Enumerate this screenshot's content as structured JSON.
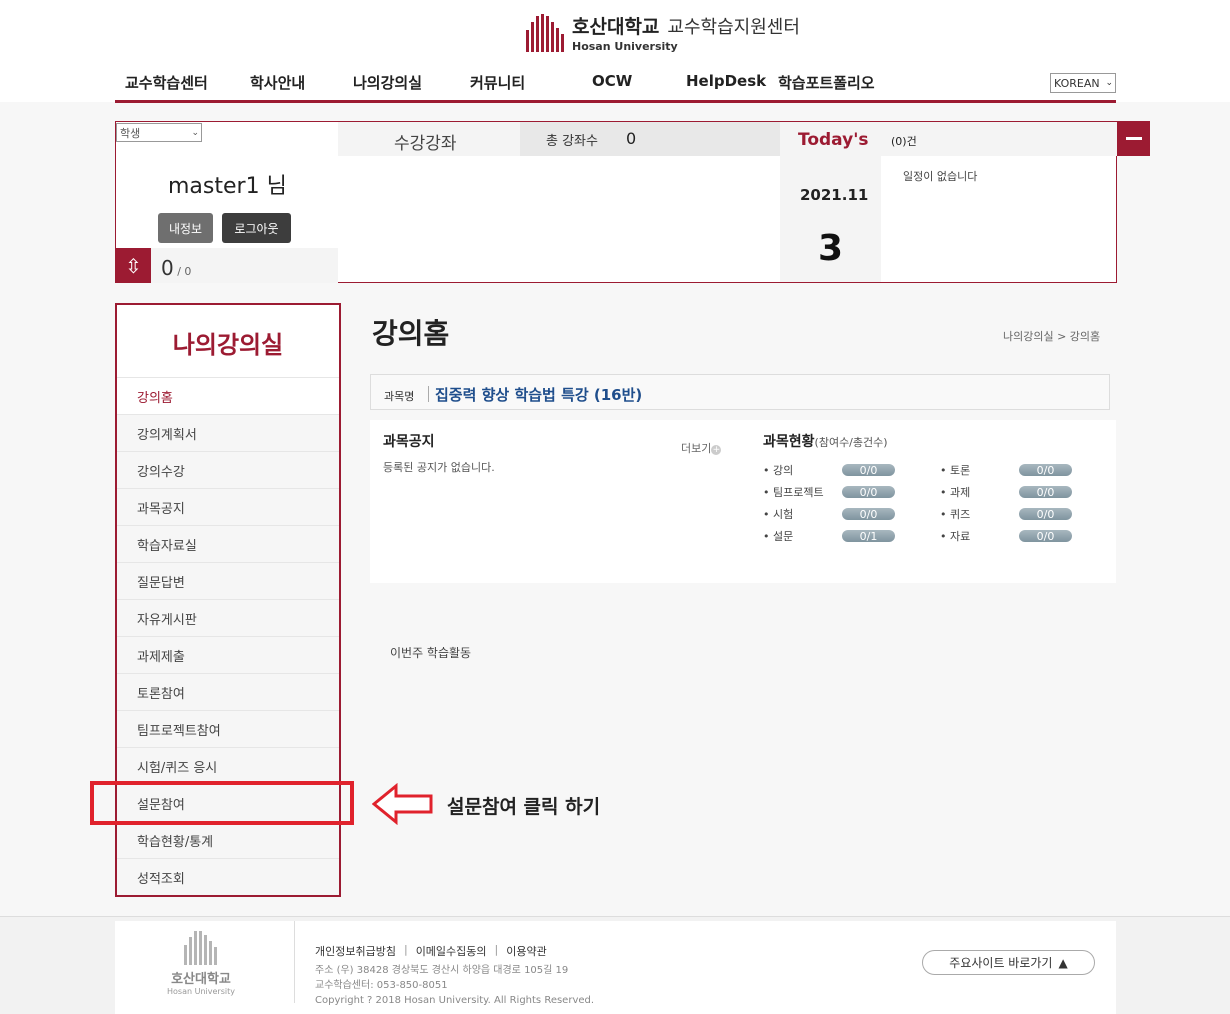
{
  "header": {
    "logo_kr": "호산대학교",
    "logo_center": "교수학습지원센터",
    "logo_en": "Hosan University",
    "lang": "KOREAN",
    "nav": [
      "교수학습센터",
      "학사안내",
      "나의강의실",
      "커뮤니티",
      "OCW",
      "HelpDesk",
      "학습포트폴리오"
    ]
  },
  "userbox": {
    "role": "학생",
    "username": "master1  님",
    "myinfo": "내정보",
    "logout": "로그아웃",
    "mini_count": "0",
    "mini_total": " / 0",
    "course_title": "수강강좌",
    "total_label": "총 강좌수",
    "total_value": "0",
    "today_label": "Today's",
    "today_ym": "2021.11",
    "today_day": "3",
    "sched_count": "(0)건",
    "sched_empty": "일정이 없습니다"
  },
  "sidebar": {
    "title": "나의강의실",
    "items": [
      {
        "label": "강의홈"
      },
      {
        "label": "강의계획서"
      },
      {
        "label": "강의수강"
      },
      {
        "label": "과목공지"
      },
      {
        "label": "학습자료실"
      },
      {
        "label": "질문답변"
      },
      {
        "label": "자유게시판"
      },
      {
        "label": "과제제출"
      },
      {
        "label": "토론참여"
      },
      {
        "label": "팀프로젝트참여"
      },
      {
        "label": "시험/퀴즈 응시"
      },
      {
        "label": "설문참여"
      },
      {
        "label": "학습현황/통계"
      },
      {
        "label": "성적조회"
      }
    ]
  },
  "annotation": {
    "text": "설문참여 클릭 하기",
    "color": "#e0222c"
  },
  "main": {
    "title": "강의홈",
    "breadcrumb": "나의강의실 > 강의홈",
    "course_label": "과목명",
    "course_name": "집중력 향상 학습법 특강 (16반)",
    "notice_title": "과목공지",
    "notice_more": "더보기",
    "notice_empty": "등록된 공지가 없습니다.",
    "status_title": "과목현황",
    "status_sub": "(참여수/총건수)",
    "stats": [
      {
        "label": "강의",
        "value": "0/0"
      },
      {
        "label": "토론",
        "value": "0/0"
      },
      {
        "label": "팀프로젝트",
        "value": "0/0"
      },
      {
        "label": "과제",
        "value": "0/0"
      },
      {
        "label": "시험",
        "value": "0/0"
      },
      {
        "label": "퀴즈",
        "value": "0/0"
      },
      {
        "label": "설문",
        "value": "0/1"
      },
      {
        "label": "자료",
        "value": "0/0"
      }
    ],
    "week_label": "이번주 학습활동"
  },
  "footer": {
    "logo_kr": "호산대학교",
    "logo_en": "Hosan University",
    "links": [
      "개인정보취급방침",
      "이메일수집동의",
      "이용약관"
    ],
    "address": "주소 (우) 38428 경상북도 경산시 하양읍 대경로 105길 19",
    "phone": "교수학습센터: 053-850-8051",
    "copyright": "Copyright ? 2018 Hosan University. All Rights Reserved.",
    "sites": "주요사이트 바로가기"
  },
  "colors": {
    "brand": "#9c1b32",
    "link": "#1f4e8c"
  }
}
